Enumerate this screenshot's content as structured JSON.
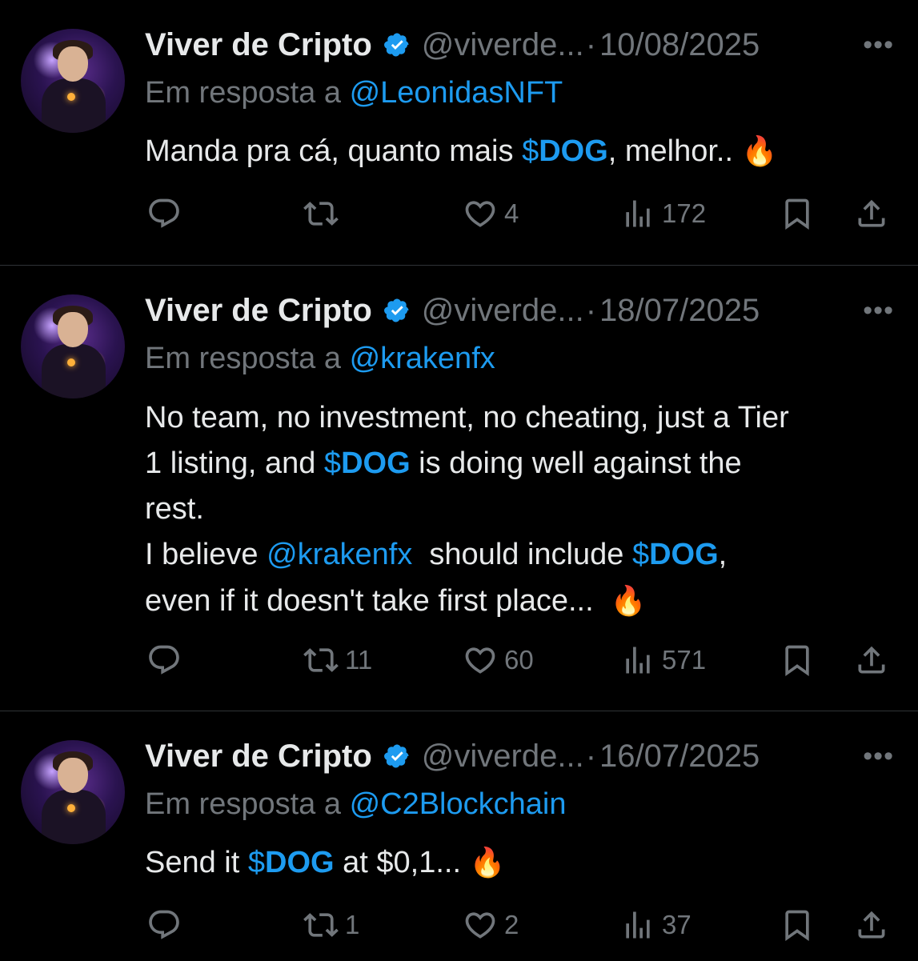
{
  "tweets": [
    {
      "name": "Viver de Cripto",
      "handle": "@viverde...",
      "sep": "·",
      "date": "10/08/2025",
      "more": "•••",
      "reply_prefix": "Em resposta a ",
      "reply_to": "@LeonidasNFT",
      "lines": [
        [
          {
            "t": "text",
            "v": "Manda pra cá, quanto mais "
          },
          {
            "t": "cash",
            "sym": "$",
            "v": "DOG"
          },
          {
            "t": "text",
            "v": ", melhor.. "
          },
          {
            "t": "fire",
            "v": "🔥"
          }
        ]
      ],
      "replies": "",
      "retweets": "",
      "likes": "4",
      "views": "172"
    },
    {
      "name": "Viver de Cripto",
      "handle": "@viverde...",
      "sep": "·",
      "date": "18/07/2025",
      "more": "•••",
      "reply_prefix": "Em resposta a ",
      "reply_to": "@krakenfx",
      "lines": [
        [
          {
            "t": "text",
            "v": "No team, no investment, no cheating, just a Tier"
          }
        ],
        [
          {
            "t": "text",
            "v": "1 listing, and "
          },
          {
            "t": "cash",
            "sym": "$",
            "v": "DOG"
          },
          {
            "t": "text",
            "v": " is doing well against the"
          }
        ],
        [
          {
            "t": "text",
            "v": "rest."
          }
        ],
        [
          {
            "t": "text",
            "v": "I believe "
          },
          {
            "t": "mention",
            "v": "@krakenfx"
          },
          {
            "t": "text",
            "v": "  should include "
          },
          {
            "t": "cash",
            "sym": "$",
            "v": "DOG"
          },
          {
            "t": "text",
            "v": ","
          }
        ],
        [
          {
            "t": "text",
            "v": "even if it doesn't take first place...  "
          },
          {
            "t": "fire",
            "v": "🔥"
          }
        ]
      ],
      "replies": "",
      "retweets": "11",
      "likes": "60",
      "views": "571"
    },
    {
      "name": "Viver de Cripto",
      "handle": "@viverde...",
      "sep": "·",
      "date": "16/07/2025",
      "more": "•••",
      "reply_prefix": "Em resposta a ",
      "reply_to": "@C2Blockchain",
      "lines": [
        [
          {
            "t": "text",
            "v": "Send it "
          },
          {
            "t": "cash",
            "sym": "$",
            "v": "DOG"
          },
          {
            "t": "text",
            "v": " at $0,1... "
          },
          {
            "t": "fire",
            "v": "🔥"
          }
        ]
      ],
      "replies": "",
      "retweets": "1",
      "likes": "2",
      "views": "37"
    }
  ],
  "colors": {
    "background": "#000000",
    "text": "#e7e9ea",
    "muted": "#71767b",
    "accent": "#1d9bf0",
    "divider": "#2f3336"
  },
  "icons": {
    "reply": "reply-icon",
    "retweet": "retweet-icon",
    "like": "heart-icon",
    "views": "views-icon",
    "bookmark": "bookmark-icon",
    "share": "share-icon",
    "verified": "verified-badge-icon"
  }
}
